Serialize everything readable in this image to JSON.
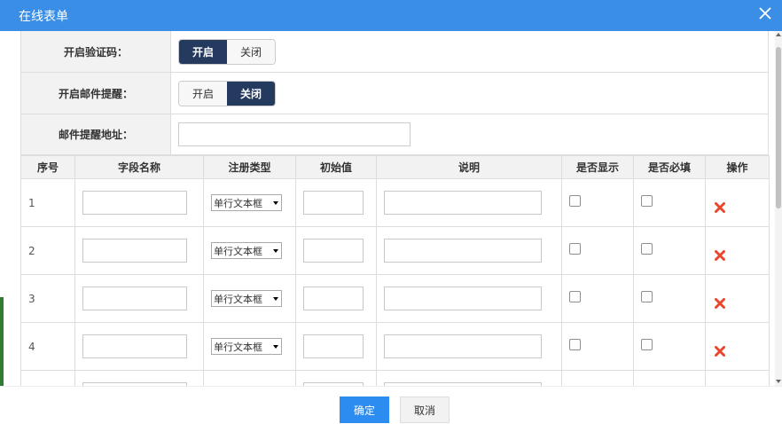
{
  "dialog": {
    "title": "在线表单"
  },
  "settings": {
    "captcha": {
      "label": "开启验证码：",
      "on_label": "开启",
      "off_label": "关闭",
      "selected": "开启"
    },
    "mail_remind": {
      "label": "开启邮件提醒：",
      "on_label": "开启",
      "off_label": "关闭",
      "selected": "关闭"
    },
    "mail_address": {
      "label": "邮件提醒地址：",
      "value": ""
    }
  },
  "table": {
    "headers": [
      "序号",
      "字段名称",
      "注册类型",
      "初始值",
      "说明",
      "是否显示",
      "是否必填",
      "操作"
    ],
    "rows": [
      {
        "index": "1",
        "field_name": "",
        "type": "单行文本框",
        "initial": "",
        "description": "",
        "show": false,
        "required": false
      },
      {
        "index": "2",
        "field_name": "",
        "type": "单行文本框",
        "initial": "",
        "description": "",
        "show": false,
        "required": false
      },
      {
        "index": "3",
        "field_name": "",
        "type": "单行文本框",
        "initial": "",
        "description": "",
        "show": false,
        "required": false
      },
      {
        "index": "4",
        "field_name": "",
        "type": "单行文本框",
        "initial": "",
        "description": "",
        "show": false,
        "required": false
      }
    ]
  },
  "footer": {
    "ok_label": "确定",
    "cancel_label": "取消"
  },
  "colors": {
    "titlebar": "#3a8ee6",
    "toggle_active": "#243a5e",
    "primary": "#2d8cf0",
    "delete": "#e8462d"
  },
  "icons": {
    "close": "close-icon",
    "delete": "delete-x-icon",
    "dropdown": "chevron-down-icon"
  }
}
